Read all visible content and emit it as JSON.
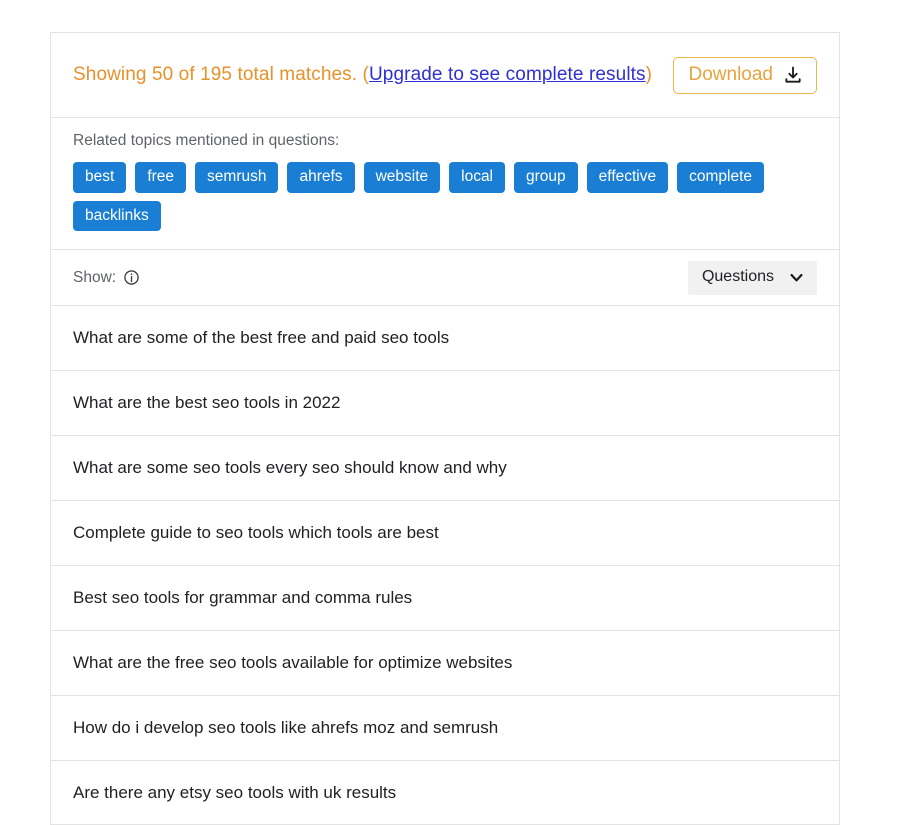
{
  "summary": {
    "prefix": "Showing 50 of 195 total matches.",
    "open_paren": "(",
    "upgrade_link": "Upgrade to see complete results",
    "close_paren": ")",
    "download_label": "Download",
    "download_icon": "download-icon",
    "accent_orange": "#e8912a",
    "link_blue": "#2f2fd6"
  },
  "topics": {
    "label": "Related topics mentioned in questions:",
    "tag_color": "#1a7fd4",
    "tags": [
      "best",
      "free",
      "semrush",
      "ahrefs",
      "website",
      "local",
      "group",
      "effective",
      "complete",
      "backlinks"
    ]
  },
  "show_bar": {
    "label": "Show:",
    "info_icon": "info-circle-icon",
    "dropdown": {
      "value": "Questions",
      "chevron_icon": "chevron-down-icon",
      "options": [
        "Questions"
      ]
    }
  },
  "questions": [
    "What are some of the best free and paid seo tools",
    "What are the best seo tools in 2022",
    "What are some seo tools every seo should know and why",
    "Complete guide to seo tools which tools are best",
    "Best seo tools for grammar and comma rules",
    "What are the free seo tools available for optimize websites",
    "How do i develop seo tools like ahrefs moz and semrush",
    "Are there any etsy seo tools with uk results"
  ]
}
